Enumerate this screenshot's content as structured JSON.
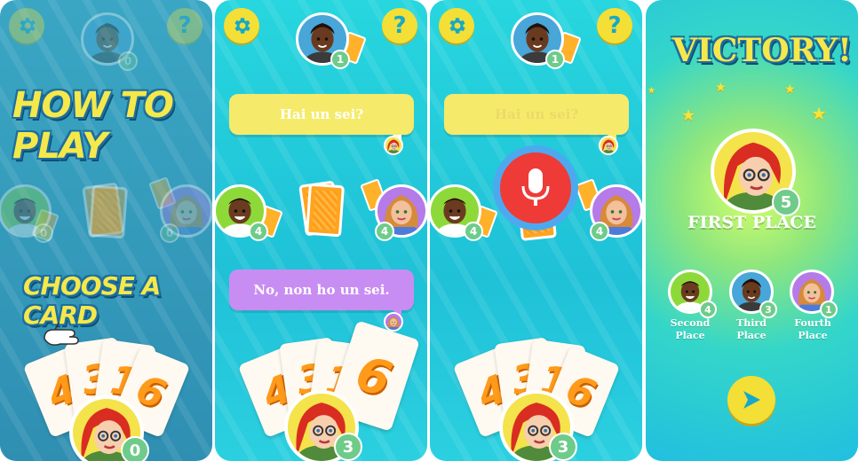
{
  "panel1": {
    "title_how_to_play": "HOW TO PLAY",
    "title_choose_card": "CHOOSE A CARD",
    "top_player_count": "0",
    "left_player_count": "0",
    "right_player_count": "0",
    "me_count": "0",
    "hand": [
      "4",
      "3",
      "1",
      "6"
    ]
  },
  "panel2": {
    "top_player_count": "1",
    "left_player_count": "4",
    "right_player_count": "4",
    "me_count": "3",
    "question_bubble": "Hai un sei?",
    "answer_bubble": "No, non ho un sei.",
    "hand": [
      "4",
      "3",
      "1",
      "6"
    ]
  },
  "panel3": {
    "top_player_count": "1",
    "left_player_count": "4",
    "right_player_count": "4",
    "me_count": "3",
    "question_bubble": "Hai un sei?",
    "hand": [
      "4",
      "3",
      "1",
      "6"
    ]
  },
  "panel4": {
    "victory": "VICTORY!",
    "first_place": "FIRST PLACE",
    "first_count": "5",
    "second_label": "Second Place",
    "second_count": "4",
    "third_label": "Third Place",
    "third_count": "3",
    "fourth_label": "Fourth Place",
    "fourth_count": "1"
  },
  "colors": {
    "accent_yellow": "#f3df36",
    "badge_green": "#6fcb8a",
    "card_orange": "#ffa41f",
    "bubble_yellow": "#f6ea6a",
    "bubble_purple": "#c88df2",
    "mic_red": "#ee3b38"
  },
  "icons": [
    "gear-icon",
    "question-icon",
    "microphone-icon",
    "play-arrow-icon",
    "hand-pointer-icon",
    "star-icon"
  ]
}
